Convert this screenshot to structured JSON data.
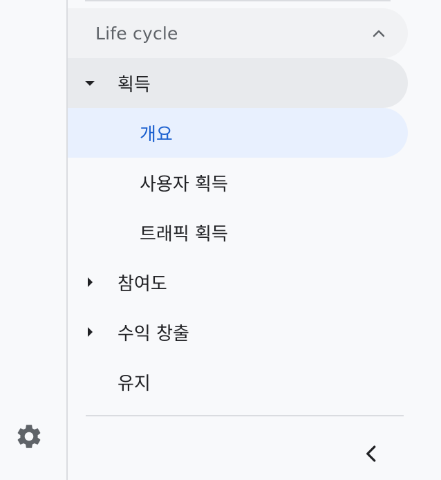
{
  "sidebar": {
    "section": {
      "label": "Life cycle",
      "expanded": true,
      "icon": "chevron-up-icon"
    },
    "items": [
      {
        "label": "획득",
        "level": 1,
        "expanded": true,
        "icon": "caret-down-icon"
      },
      {
        "label": "개요",
        "level": 2,
        "active": true
      },
      {
        "label": "사용자 획득",
        "level": 2
      },
      {
        "label": "트래픽 획득",
        "level": 2
      },
      {
        "label": "참여도",
        "level": 1,
        "expanded": false,
        "icon": "caret-right-icon"
      },
      {
        "label": "수익 창출",
        "level": 1,
        "expanded": false,
        "icon": "caret-right-icon"
      },
      {
        "label": "유지",
        "level": 1
      }
    ],
    "footer": {
      "settings_icon": "gear-icon",
      "collapse_icon": "chevron-left-icon"
    }
  },
  "colors": {
    "background": "#f8f9fb",
    "active_bg": "#e8f0fe",
    "active_text": "#1a5fcf",
    "expanded_bg": "#e8eaed",
    "header_bg": "#f1f2f4",
    "icon": "#5f6368"
  }
}
